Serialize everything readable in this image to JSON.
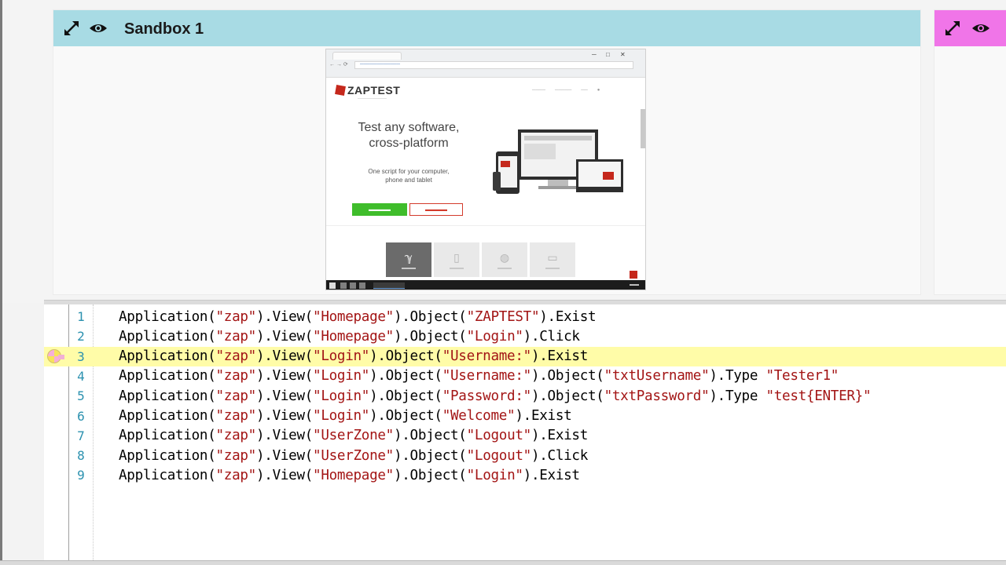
{
  "sandbox1": {
    "title": "Sandbox 1",
    "header_color": "#a8dbe4"
  },
  "sandbox2": {
    "header_color": "#f075e8"
  },
  "thumbnail": {
    "brand": "ZAPTEST",
    "headline_1": "Test any software,",
    "headline_2": "cross-platform",
    "subtext_1": "One script for your computer,",
    "subtext_2": "phone and tablet",
    "tiles": [
      "tile-app",
      "tile-mobile",
      "tile-web",
      "tile-desktop"
    ]
  },
  "editor": {
    "highlight_color": "#fffca8",
    "lines": [
      {
        "num": "1",
        "code": "Application(\"zap\").View(\"Homepage\").Object(\"ZAPTEST\").Exist"
      },
      {
        "num": "2",
        "code": "Application(\"zap\").View(\"Homepage\").Object(\"Login\").Click"
      },
      {
        "num": "3",
        "code": "Application(\"zap\").View(\"Login\").Object(\"Username:\").Exist",
        "highlight": true
      },
      {
        "num": "4",
        "code": "Application(\"zap\").View(\"Login\").Object(\"Username:\").Object(\"txtUsername\").Type \"Tester1\""
      },
      {
        "num": "5",
        "code": "Application(\"zap\").View(\"Login\").Object(\"Password:\").Object(\"txtPassword\").Type \"test{ENTER}\""
      },
      {
        "num": "6",
        "code": "Application(\"zap\").View(\"Login\").Object(\"Welcome\").Exist"
      },
      {
        "num": "7",
        "code": "Application(\"zap\").View(\"UserZone\").Object(\"Logout\").Exist"
      },
      {
        "num": "8",
        "code": "Application(\"zap\").View(\"UserZone\").Object(\"Logout\").Click"
      },
      {
        "num": "9",
        "code": "Application(\"zap\").View(\"Homepage\").Object(\"Login\").Exist"
      }
    ]
  },
  "icons": {
    "expand": "expand-icon",
    "view": "eye-icon",
    "breakpoint": "breakpoint-marker-icon"
  }
}
